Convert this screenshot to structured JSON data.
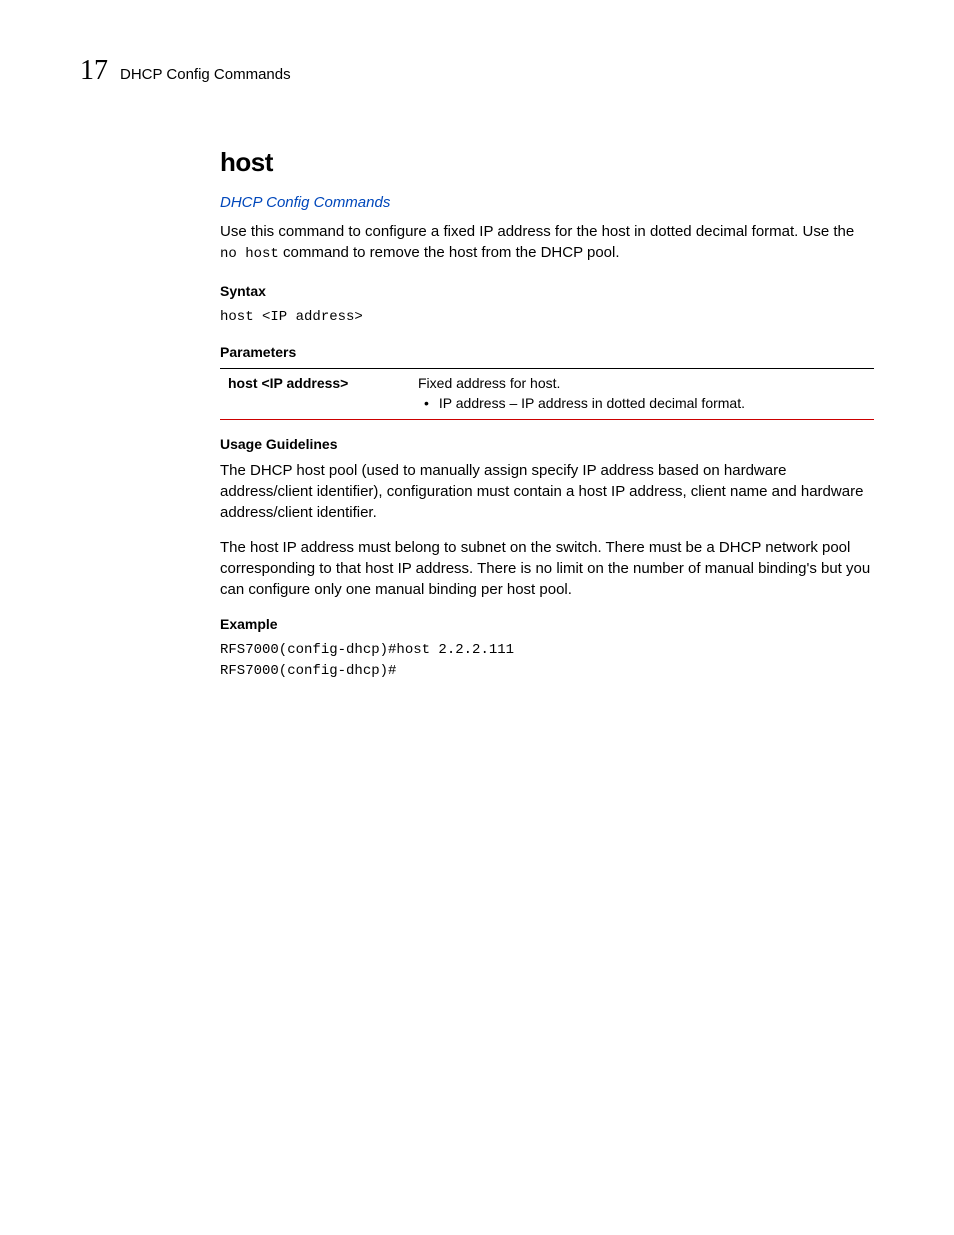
{
  "header": {
    "chapter_number": "17",
    "chapter_title": "DHCP Config Commands"
  },
  "section": {
    "title": "host",
    "link": "DHCP Config Commands",
    "intro_part1": "Use this command to configure a fixed IP address for the host in dotted decimal format. Use the ",
    "intro_code1": "no host",
    "intro_part2": " command to remove the host from the DHCP pool."
  },
  "syntax": {
    "heading": "Syntax",
    "code": "host <IP address>"
  },
  "parameters": {
    "heading": "Parameters",
    "row": {
      "name": "host <IP address>",
      "desc": "Fixed address for host.",
      "bullet": "IP address – IP address in dotted decimal format."
    }
  },
  "usage": {
    "heading": "Usage Guidelines",
    "para1": "The DHCP host pool (used to manually assign specify IP address based on hardware address/client identifier), configuration must contain a host IP address, client name and hardware address/client identifier.",
    "para2": "The host IP address must belong to subnet on the switch. There must be a DHCP network pool corresponding to that host IP address. There is no limit on the number of manual binding's but you can configure only one manual binding per host pool."
  },
  "example": {
    "heading": "Example",
    "code": "RFS7000(config-dhcp)#host 2.2.2.111\nRFS7000(config-dhcp)#"
  }
}
